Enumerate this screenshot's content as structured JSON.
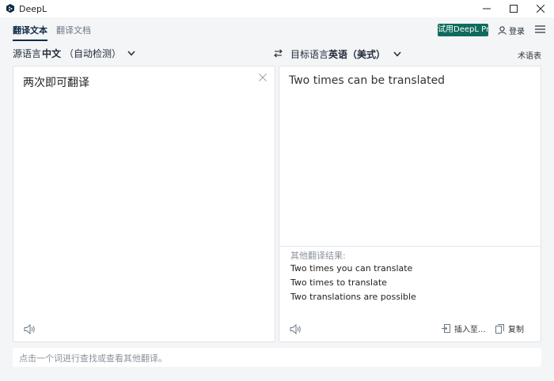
{
  "window": {
    "title": "DeepL",
    "controls": [
      "minimize-icon",
      "maximize-icon",
      "close-icon"
    ]
  },
  "nav": {
    "tabs": [
      {
        "label": "翻译文本",
        "active": true
      },
      {
        "label": "翻译文档",
        "active": false
      }
    ],
    "pro_badge": "试用DeepL Pro",
    "login_label": "登录",
    "menu_icon": "hamburger-icon"
  },
  "source": {
    "label": "源语言",
    "language": "中文",
    "sublabel": "（自动检测）",
    "text": "两次即可翻译"
  },
  "target": {
    "label": "目标语言",
    "language": "英语（美式）",
    "text": "Two times can be translated",
    "glossary_label": "术语表",
    "alternatives_heading": "其他翻译结果:",
    "alternatives": [
      "Two times you can translate",
      "Two times to translate",
      "Two translations are possible"
    ],
    "insert_label": "插入至...",
    "copy_label": "复制"
  },
  "dictionary": {
    "hint": "点击一个词进行查找或查看其他翻译。"
  },
  "colors": {
    "accent": "#0f2b46",
    "pro_badge": "#0f6b5e",
    "background": "#f4f5f7",
    "panel": "#ffffff"
  }
}
